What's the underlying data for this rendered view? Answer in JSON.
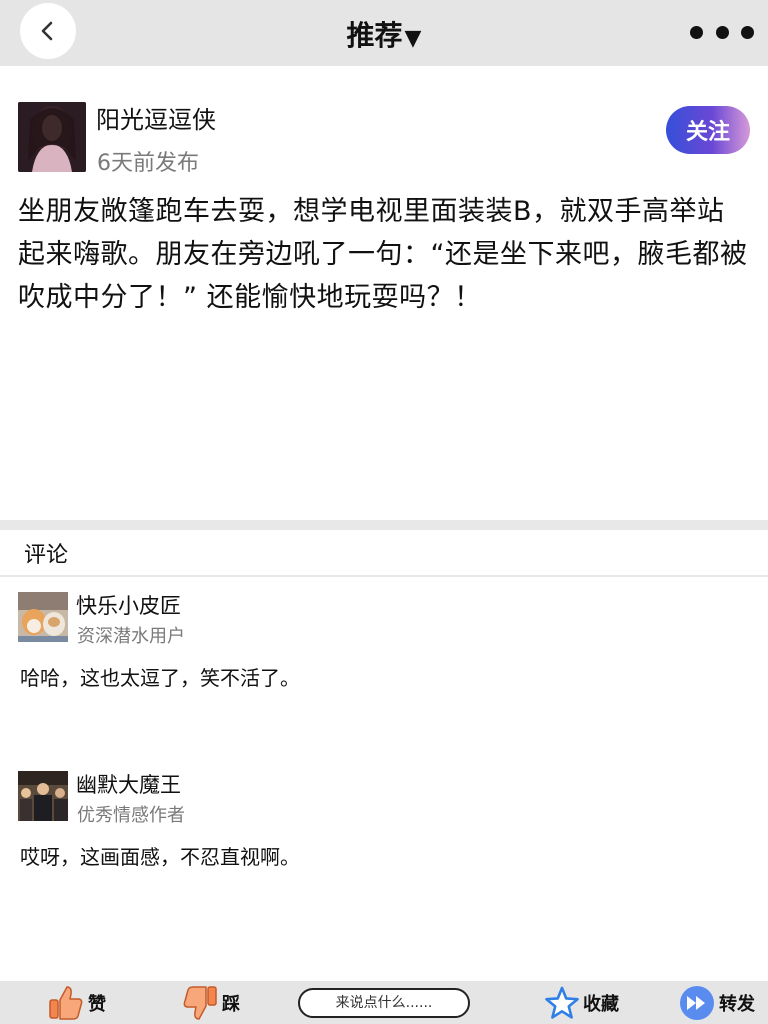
{
  "nav": {
    "title": "推荐",
    "caret": "▼"
  },
  "author": {
    "name": "阳光逗逗侠",
    "meta": "6天前发布",
    "follow_label": "关注"
  },
  "post": {
    "text": "坐朋友敞篷跑车去耍，想学电视里面装装B，就双手高举站起来嗨歌。朋友在旁边吼了一句：“还是坐下来吧，腋毛都被吹成中分了！” 还能愉快地玩耍吗？！"
  },
  "comments_title": "评论",
  "comments": [
    {
      "name": "快乐小皮匠",
      "title": "资深潜水用户",
      "text": "哈哈，这也太逗了，笑不活了。"
    },
    {
      "name": "幽默大魔王",
      "title": "优秀情感作者",
      "text": "哎呀，这画面感，不忍直视啊。"
    }
  ],
  "bottom_bar": {
    "like_label": "赞",
    "dislike_label": "踩",
    "comment_placeholder": "来说点什么......",
    "favorite_label": "收藏",
    "share_label": "转发"
  },
  "colors": {
    "nav_bg": "#e5e5e5",
    "follow_gradient_start": "#3550d8",
    "follow_gradient_end": "#d69ad8",
    "star_blue": "#2f7fe6",
    "thumb_orange": "#f2864e",
    "share_blue": "#5a8cf0"
  },
  "icons": {
    "back": "chevron-left-icon",
    "more": "ellipsis-icon",
    "like": "thumbs-up-icon",
    "dislike": "thumbs-down-icon",
    "favorite": "star-icon",
    "share": "fast-forward-icon"
  }
}
